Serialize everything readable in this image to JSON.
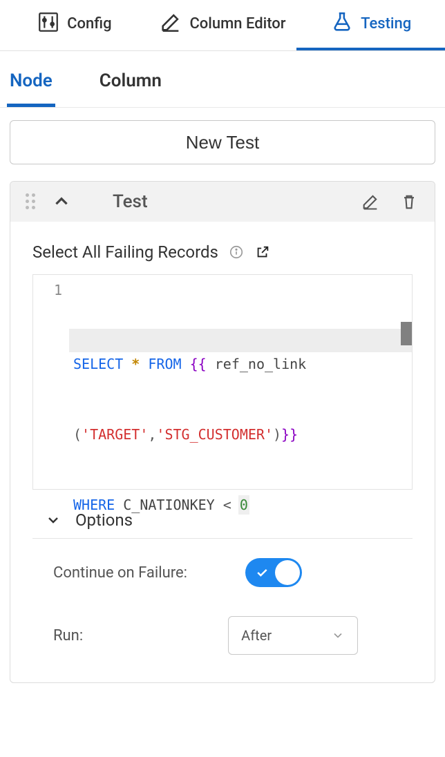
{
  "top_tabs": {
    "config": "Config",
    "column_editor": "Column Editor",
    "testing": "Testing",
    "active": "testing"
  },
  "sub_tabs": {
    "node": "Node",
    "column": "Column",
    "active": "node"
  },
  "new_test_label": "New Test",
  "test_panel": {
    "title": "Test",
    "section_label": "Select All Failing Records",
    "code": {
      "line_number": "1",
      "tokens": {
        "select": "SELECT",
        "star": "*",
        "from": "FROM",
        "open_braces": "{{",
        "fn": "ref_no_link",
        "lparen": "(",
        "arg1": "'TARGET'",
        "comma": ",",
        "arg2": "'STG_CUSTOMER'",
        "rparen": ")",
        "close_braces": "}}",
        "where": "WHERE",
        "col": "C_NATIONKEY",
        "lt": "<",
        "zero": "0"
      }
    },
    "options": {
      "title": "Options",
      "continue_label": "Continue on Failure:",
      "continue_value": true,
      "run_label": "Run:",
      "run_value": "After"
    }
  }
}
